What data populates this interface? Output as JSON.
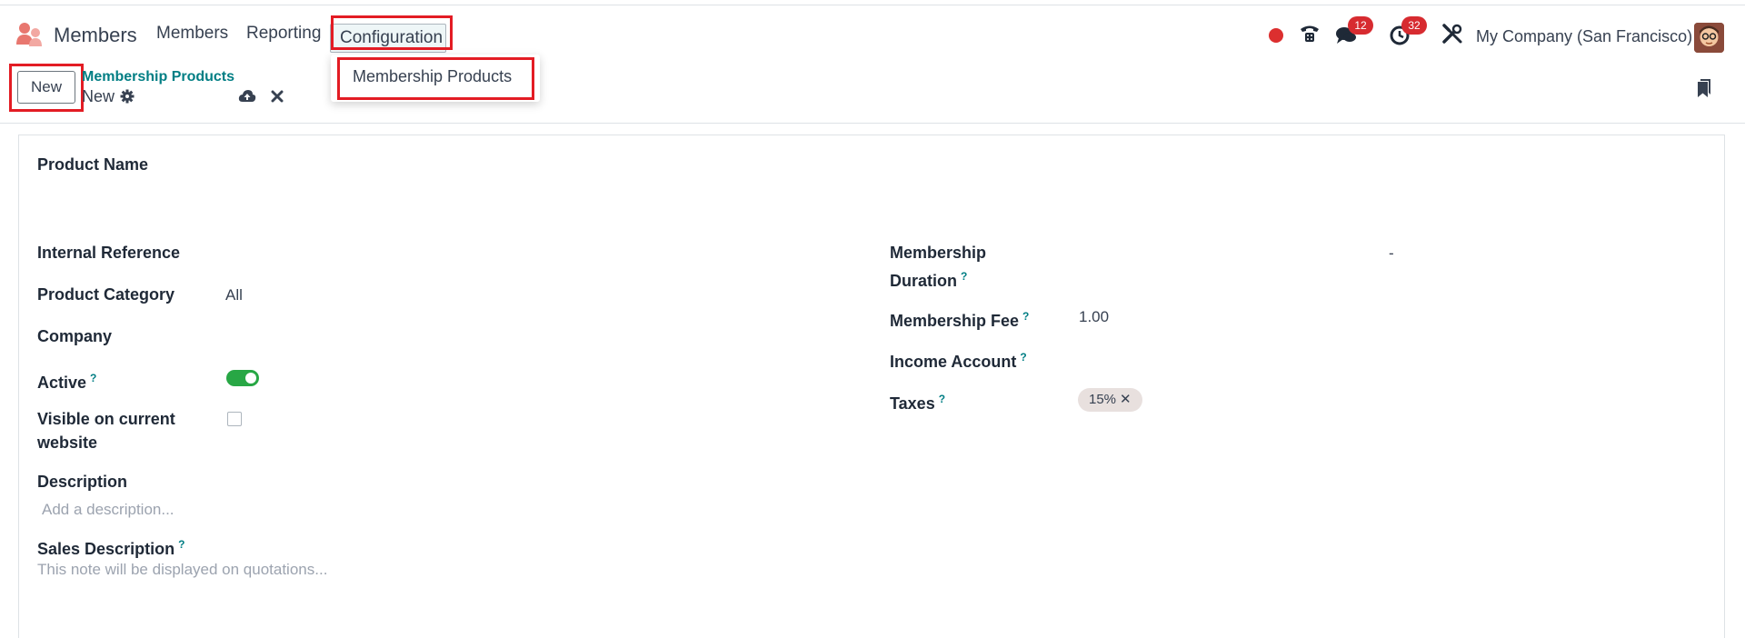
{
  "navbar": {
    "app_name": "Members",
    "menu": {
      "members": "Members",
      "reporting": "Reporting",
      "configuration": "Configuration"
    },
    "messages_count": "12",
    "activities_count": "32",
    "company": "My Company (San Francisco)"
  },
  "dropdown": {
    "item": "Membership Products"
  },
  "control_panel": {
    "new_label": "New",
    "breadcrumb": "Membership Products",
    "record_name": "New"
  },
  "form": {
    "product_name_label": "Product Name",
    "internal_reference_label": "Internal Reference",
    "product_category_label": "Product Category",
    "product_category_value": "All",
    "company_label": "Company",
    "active_label": "Active",
    "visible_label_line1": "Visible on current",
    "visible_label_line2": "website",
    "description_label": "Description",
    "description_placeholder": "Add a description...",
    "sales_description_label": "Sales Description",
    "sales_description_placeholder": "This note will be displayed on quotations...",
    "membership_duration_label_line1": "Membership",
    "membership_duration_label_line2": "Duration",
    "membership_duration_separator": "-",
    "membership_fee_label": "Membership Fee",
    "membership_fee_value": "1.00",
    "income_account_label": "Income Account",
    "taxes_label": "Taxes",
    "tax_tag": "15%",
    "tooltip_mark": "?",
    "active_on": true,
    "visible_checked": false
  },
  "colors": {
    "accent": "#017e84",
    "highlight": "#e31c24",
    "toggle_on": "#28a745",
    "badge": "#d72b30"
  }
}
